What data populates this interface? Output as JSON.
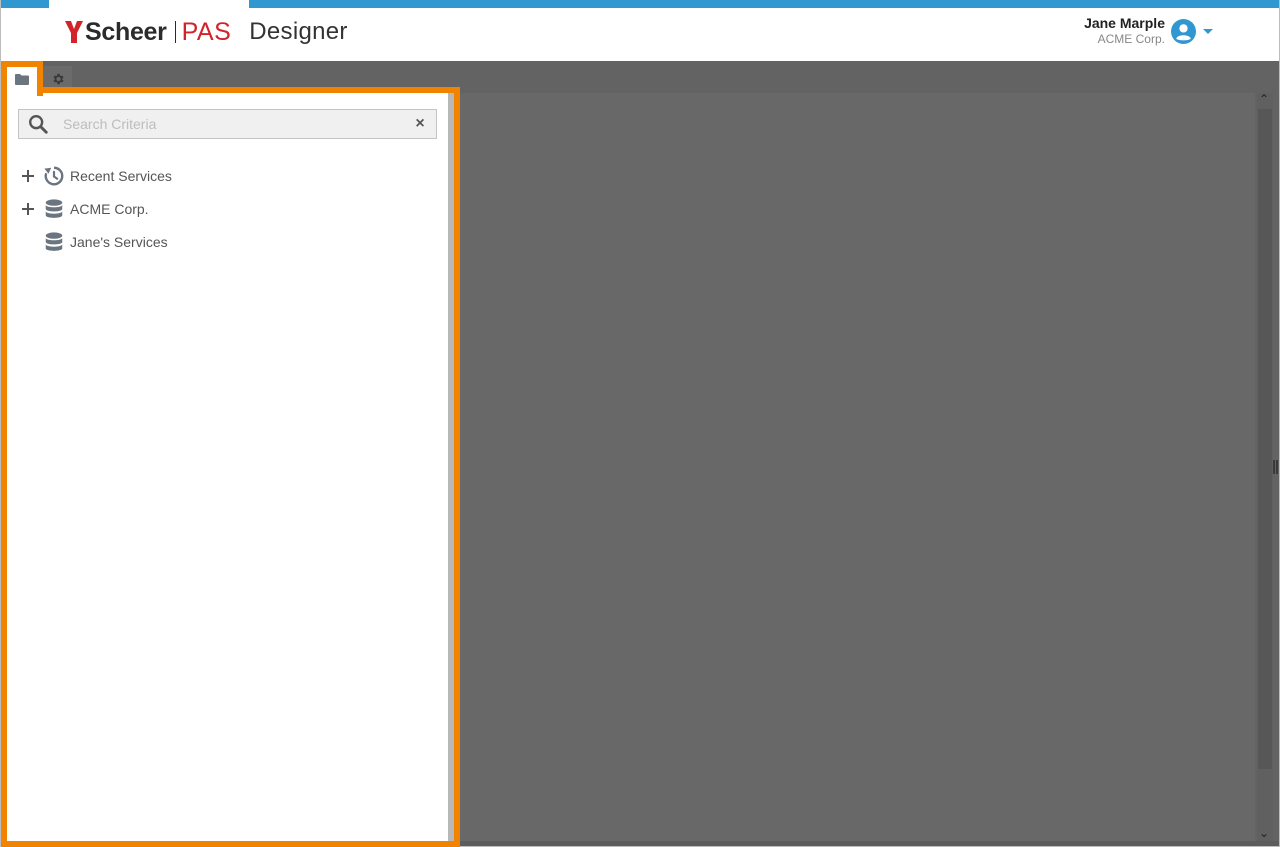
{
  "header": {
    "logo_brand": "Scheer",
    "logo_product": "PAS",
    "app_name": "Designer",
    "user": {
      "name": "Jane Marple",
      "organization": "ACME Corp."
    },
    "colors": {
      "accent": "#3197d1",
      "brand_red": "#d2232a",
      "highlight": "#f08300"
    }
  },
  "sidebar": {
    "tabs": [
      {
        "icon": "folder-icon",
        "label": "Explorer",
        "active": true
      },
      {
        "icon": "gear-icon",
        "label": "Settings",
        "active": false
      }
    ],
    "search": {
      "placeholder": "Search Criteria",
      "value": "",
      "clear_label": "×"
    },
    "tree": [
      {
        "label": "Recent Services",
        "icon": "history-icon",
        "expandable": true
      },
      {
        "label": "ACME Corp.",
        "icon": "database-icon",
        "expandable": true
      },
      {
        "label": "Jane's Services",
        "icon": "database-icon",
        "expandable": false
      }
    ]
  },
  "scrollbar": {
    "up_glyph": "⌃",
    "down_glyph": "⌄"
  }
}
